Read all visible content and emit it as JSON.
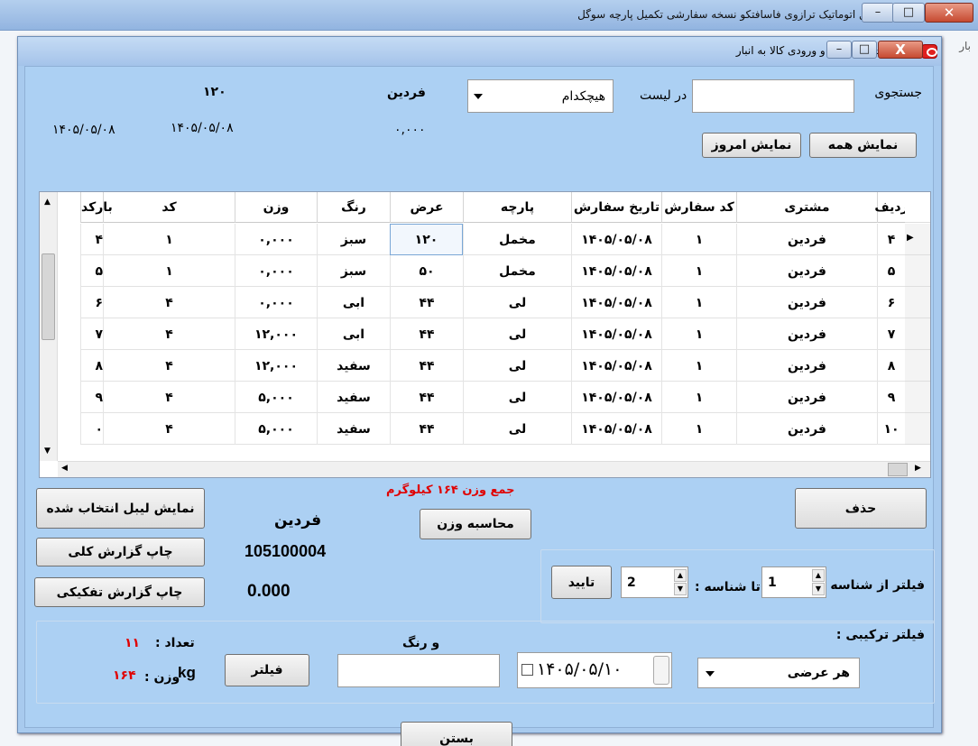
{
  "outer": {
    "title": "نرم افزار چاپ لیبل اتوماتیک ترازوی فاسافتکو نسخه سفارشی تکمیل پارچه سوگل",
    "left_fragment": "بار",
    "min": "–",
    "max": "□",
    "close": "✕"
  },
  "dialog": {
    "title": "گزارشات چاپ لیبل و ورودی کالا به انبار",
    "min": "–",
    "max": "□",
    "close": "X"
  },
  "search": {
    "label": "جستجوی",
    "value": "",
    "in_list_label": "در لیست",
    "list_value": "هیچکدام"
  },
  "header_info": {
    "customer": "فردین",
    "width": "۱۲۰",
    "weight": "۰,۰۰۰",
    "date1": "۱۴۰۵/۰۵/۰۸",
    "date2": "۱۴۰۵/۰۵/۰۸"
  },
  "buttons": {
    "show_all": "نمایش همه",
    "show_today": "نمایش امروز",
    "delete": "حذف",
    "calc_weight": "محاسبه وزن",
    "show_selected_label": "نمایش لیبل انتخاب شده",
    "print_total": "چاپ گزارش کلی",
    "print_detail": "چاپ گزارش تفکیکی",
    "confirm": "تایید",
    "filter": "فیلتر",
    "close": "بستن"
  },
  "grid": {
    "columns": [
      "ردیف",
      "مشتری",
      "کد سفارش",
      "تاریخ سفارش",
      "پارچه",
      "عرض",
      "رنگ",
      "وزن",
      "کد",
      "بارکد"
    ],
    "rows": [
      {
        "radif": "۴",
        "customer": "فردین",
        "order_code": "۱",
        "order_date": "۱۴۰۵/۰۵/۰۸",
        "fabric": "مخمل",
        "width": "۱۲۰",
        "color": "سبز",
        "weight": "۰,۰۰۰",
        "code": "۱",
        "barcode": "۴"
      },
      {
        "radif": "۵",
        "customer": "فردین",
        "order_code": "۱",
        "order_date": "۱۴۰۵/۰۵/۰۸",
        "fabric": "مخمل",
        "width": "۵۰",
        "color": "سبز",
        "weight": "۰,۰۰۰",
        "code": "۱",
        "barcode": "۵"
      },
      {
        "radif": "۶",
        "customer": "فردین",
        "order_code": "۱",
        "order_date": "۱۴۰۵/۰۵/۰۸",
        "fabric": "لی",
        "width": "۴۴",
        "color": "ابی",
        "weight": "۰,۰۰۰",
        "code": "۴",
        "barcode": "۶"
      },
      {
        "radif": "۷",
        "customer": "فردین",
        "order_code": "۱",
        "order_date": "۱۴۰۵/۰۵/۰۸",
        "fabric": "لی",
        "width": "۴۴",
        "color": "ابی",
        "weight": "۱۲,۰۰۰",
        "code": "۴",
        "barcode": "۷"
      },
      {
        "radif": "۸",
        "customer": "فردین",
        "order_code": "۱",
        "order_date": "۱۴۰۵/۰۵/۰۸",
        "fabric": "لی",
        "width": "۴۴",
        "color": "سفید",
        "weight": "۱۲,۰۰۰",
        "code": "۴",
        "barcode": "۸"
      },
      {
        "radif": "۹",
        "customer": "فردین",
        "order_code": "۱",
        "order_date": "۱۴۰۵/۰۵/۰۸",
        "fabric": "لی",
        "width": "۴۴",
        "color": "سفید",
        "weight": "۵,۰۰۰",
        "code": "۴",
        "barcode": "۹"
      },
      {
        "radif": "۱۰",
        "customer": "فردین",
        "order_code": "۱",
        "order_date": "۱۴۰۵/۰۵/۰۸",
        "fabric": "لی",
        "width": "۴۴",
        "color": "سفید",
        "weight": "۵,۰۰۰",
        "code": "۴",
        "barcode": "۰"
      }
    ]
  },
  "summary": {
    "total_weight": "جمع وزن ۱۶۴ کیلوگرم",
    "customer": "فردین",
    "barcode": "105100004",
    "weight": "0.000"
  },
  "id_filter": {
    "label_from": "فیلتر از شناسه :",
    "from_value": "1",
    "label_to": "تا شناسه :",
    "to_value": "2"
  },
  "combo_filter": {
    "label": "فیلتر ترکیبی :",
    "width_value": "هر عرضی",
    "date_value": "۱۴۰۵/۰۵/۱۰",
    "color_label": "و رنگ",
    "color_value": "",
    "count_label": "تعداد :",
    "count_value": "۱۱",
    "weight_label": "وزن :",
    "weight_value": "۱۶۴",
    "weight_unit": "kg"
  },
  "colors": {
    "dialog_bg": "#acd0f3",
    "accent_red": "#e00000"
  }
}
